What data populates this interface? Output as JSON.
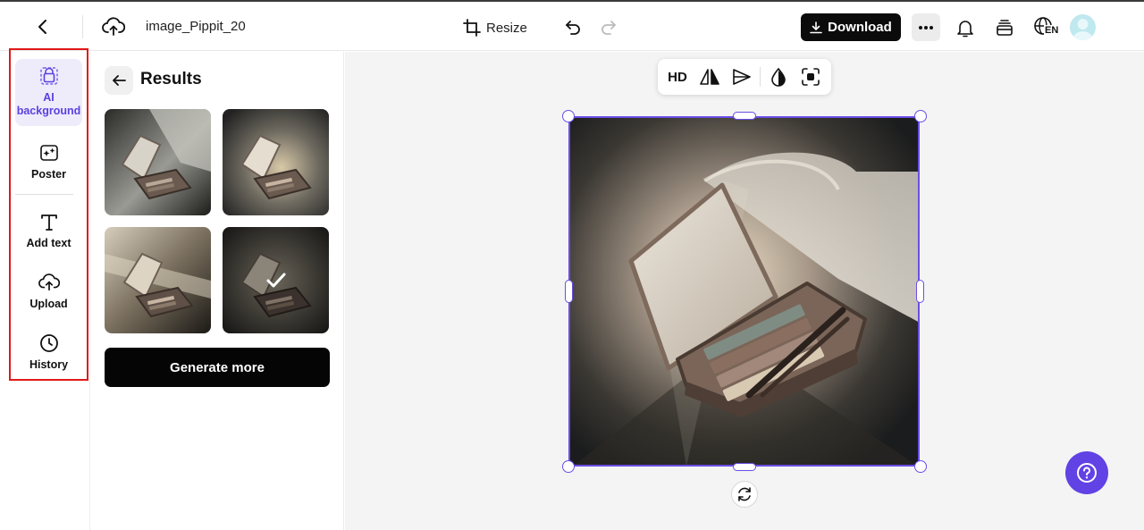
{
  "topbar": {
    "file_name": "image_Pippit_20",
    "resize_label": "Resize",
    "download_label": "Download",
    "language_code": "EN"
  },
  "rail": {
    "items": [
      {
        "label": "AI background",
        "icon": "bag-sparkle-icon",
        "active": true
      },
      {
        "label": "Poster",
        "icon": "poster-icon"
      },
      {
        "label": "Add text",
        "icon": "text-icon"
      },
      {
        "label": "Upload",
        "icon": "cloud-upload-icon"
      },
      {
        "label": "History",
        "icon": "clock-icon"
      }
    ],
    "highlight_color": "#e11919"
  },
  "panel": {
    "title": "Results",
    "generate_label": "Generate more",
    "thumbnails": [
      {
        "selected": false
      },
      {
        "selected": false
      },
      {
        "selected": false
      },
      {
        "selected": true
      }
    ]
  },
  "canvas": {
    "toolbar": {
      "hd_label": "HD",
      "tools": [
        "flip-icon",
        "cutout-icon",
        "opacity-icon",
        "focus-icon"
      ]
    }
  },
  "colors": {
    "accent": "#6142e4",
    "selection": "#6a4ee6",
    "primary_button": "#0b0b0b"
  }
}
